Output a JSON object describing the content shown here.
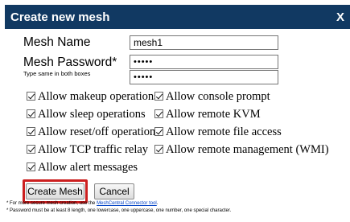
{
  "dialog": {
    "title": "Create new mesh",
    "close_label": "X"
  },
  "form": {
    "mesh_name_label": "Mesh Name",
    "mesh_name_value": "mesh1",
    "password_label": "Mesh Password*",
    "password_hint": "Type same in both boxes",
    "password_value": "•••••",
    "password_confirm_value": "•••••"
  },
  "options": [
    {
      "label": "Allow makeup operations",
      "checked": true
    },
    {
      "label": "Allow console prompt",
      "checked": true
    },
    {
      "label": "Allow sleep operations",
      "checked": true
    },
    {
      "label": "Allow remote KVM",
      "checked": true
    },
    {
      "label": "Allow reset/off operations",
      "checked": true
    },
    {
      "label": "Allow remote file access",
      "checked": true
    },
    {
      "label": "Allow TCP traffic relay",
      "checked": true
    },
    {
      "label": "Allow remote management (WMI)",
      "checked": true
    },
    {
      "label": "Allow alert messages",
      "checked": true
    }
  ],
  "buttons": {
    "create_label": "Create Mesh",
    "cancel_label": "Cancel"
  },
  "notes": {
    "line1_prefix": "* For more secure mesh creation, use the ",
    "line1_link": "MeshCentral Connector tool",
    "line1_suffix": ".",
    "line2": "* Password must be at least 8 length, one lowercase, one uppercase, one number, one special character."
  },
  "colors": {
    "titlebar": "#113962",
    "highlight": "#cc1f1f",
    "link": "#0645c6"
  }
}
